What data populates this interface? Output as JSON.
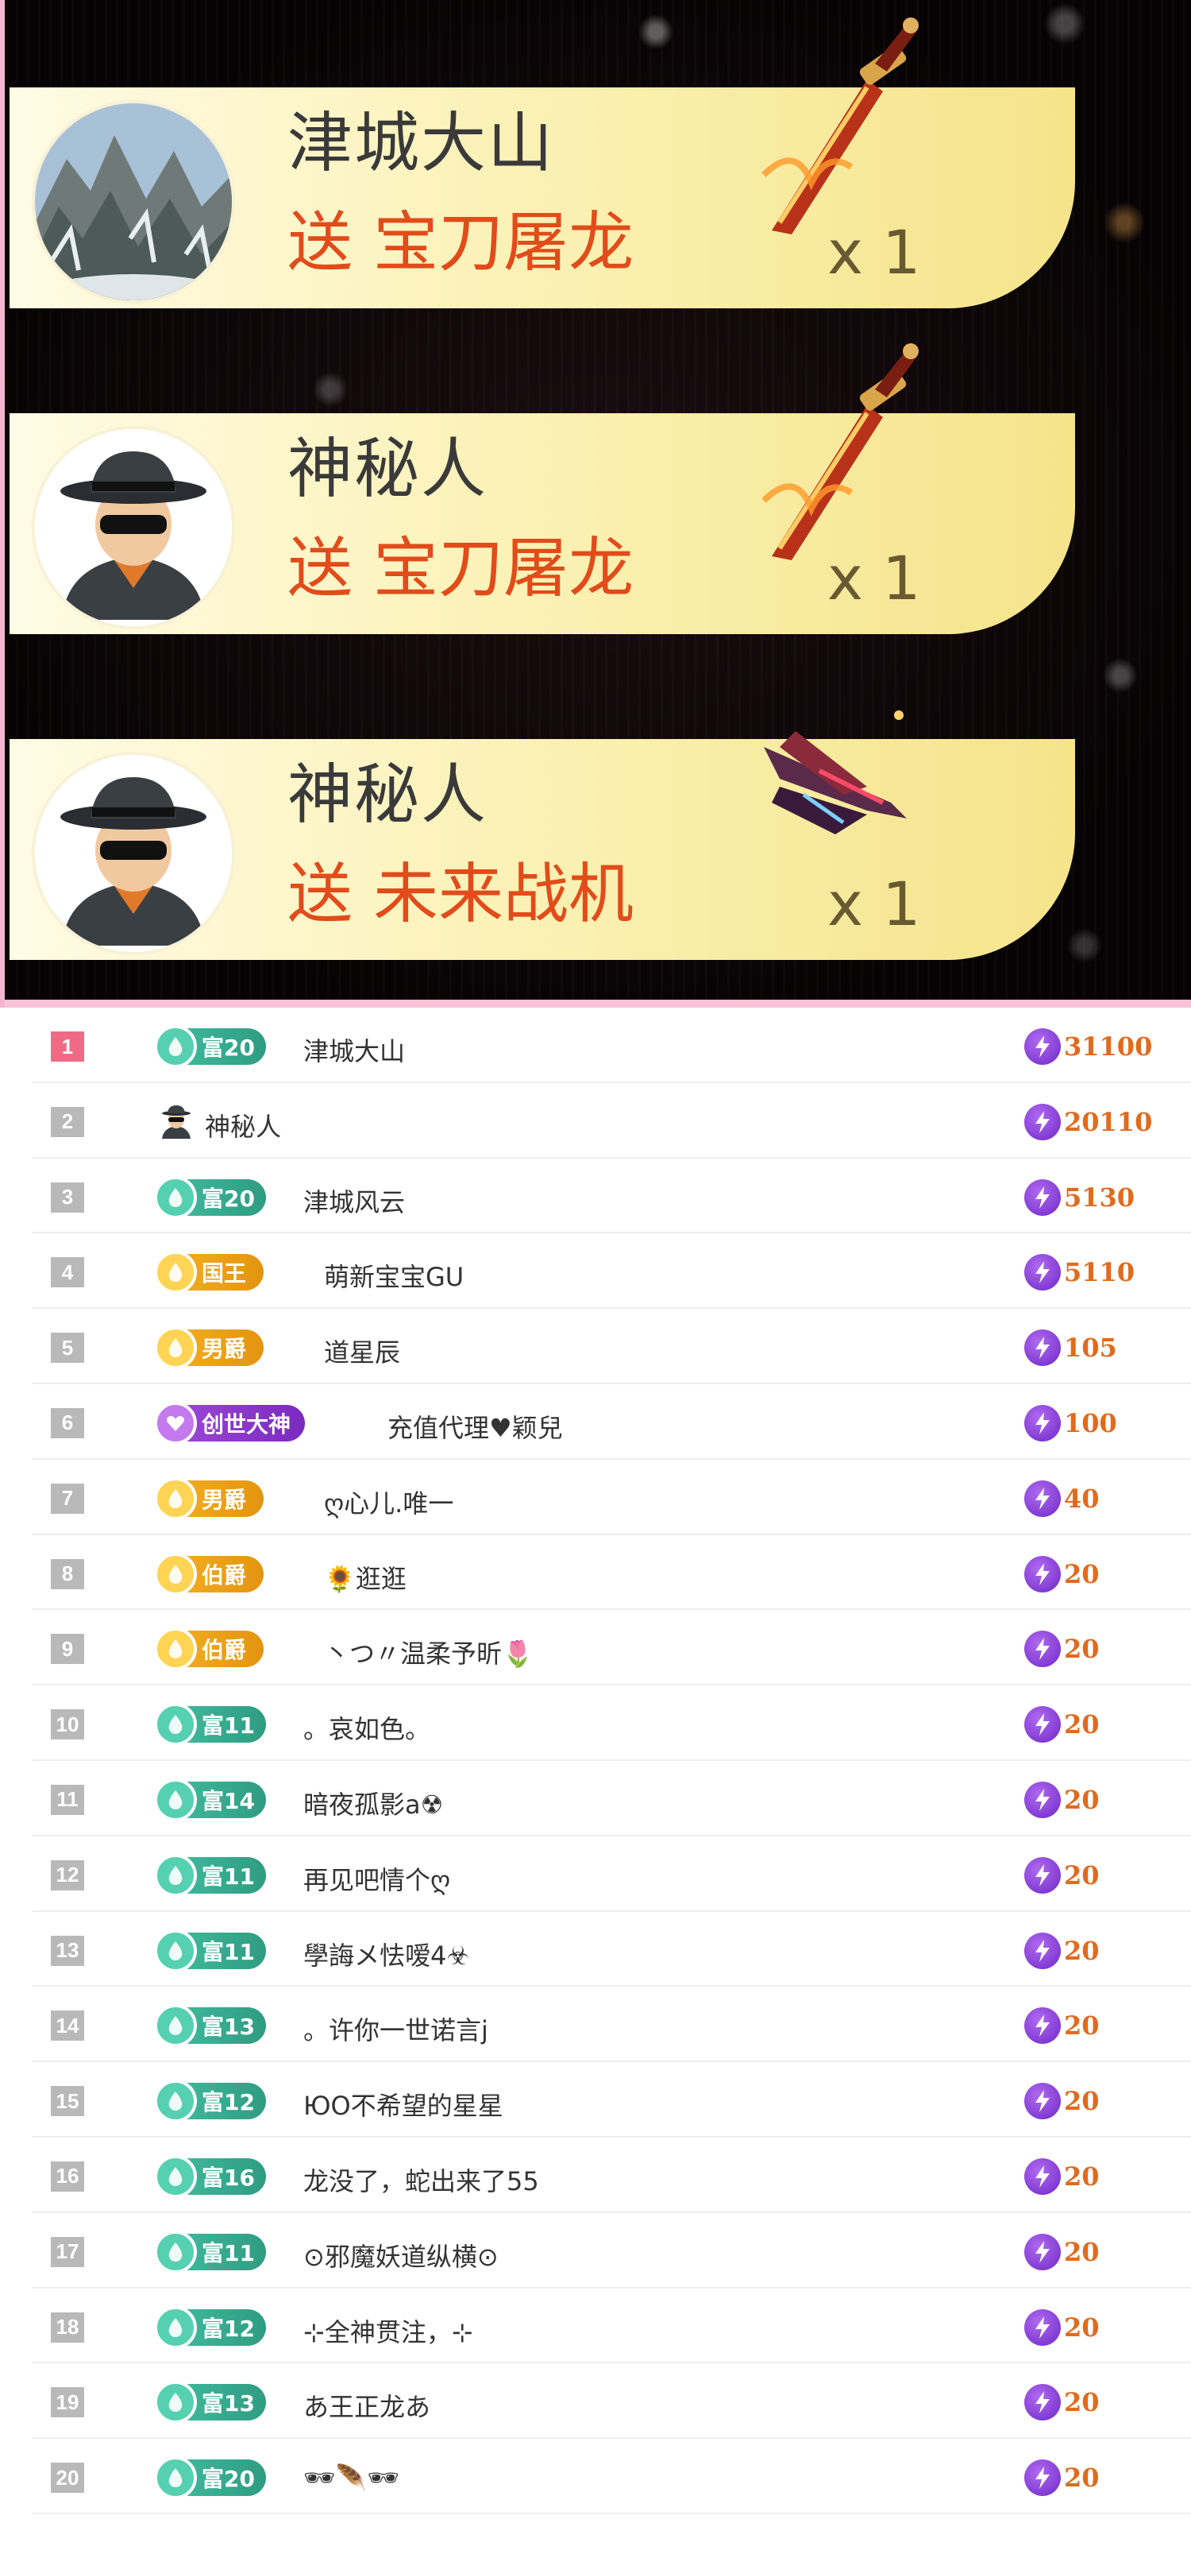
{
  "gift_feed": [
    {
      "sender": "津城大山",
      "verb": "送",
      "gift": "宝刀屠龙",
      "count": "x 1",
      "avatar": "landscape-avatar",
      "gift_icon": "dragon-sword-icon"
    },
    {
      "sender": "神秘人",
      "verb": "送",
      "gift": "宝刀屠龙",
      "count": "x 1",
      "avatar": "mystery-man-avatar",
      "gift_icon": "dragon-sword-icon"
    },
    {
      "sender": "神秘人",
      "verb": "送",
      "gift": "未来战机",
      "count": "x 1",
      "avatar": "mystery-man-avatar",
      "gift_icon": "future-fighter-jet-icon"
    }
  ],
  "ranking": [
    {
      "rank": "1",
      "badge_type": "rich",
      "badge_label": "富20",
      "name": "津城大山",
      "score": "31100"
    },
    {
      "rank": "2",
      "badge_type": "mystery",
      "badge_label": "",
      "name": "神秘人",
      "score": "20110"
    },
    {
      "rank": "3",
      "badge_type": "rich",
      "badge_label": "富20",
      "name": "津城风云",
      "score": "5130"
    },
    {
      "rank": "4",
      "badge_type": "noble",
      "badge_label": "国王",
      "name": "萌新宝宝GU",
      "score": "5110"
    },
    {
      "rank": "5",
      "badge_type": "noble",
      "badge_label": "男爵",
      "name": "道星辰",
      "score": "105"
    },
    {
      "rank": "6",
      "badge_type": "god",
      "badge_label": "创世大神",
      "name": "充值代理♥颖兒",
      "score": "100"
    },
    {
      "rank": "7",
      "badge_type": "noble",
      "badge_label": "男爵",
      "name": "ღ心儿.唯一",
      "score": "40"
    },
    {
      "rank": "8",
      "badge_type": "noble",
      "badge_label": "伯爵",
      "name": "🌻逛逛",
      "score": "20"
    },
    {
      "rank": "9",
      "badge_type": "noble",
      "badge_label": "伯爵",
      "name": "丶つ〃温柔予昕🌷",
      "score": "20"
    },
    {
      "rank": "10",
      "badge_type": "rich",
      "badge_label": "富11",
      "name": "。哀如色。",
      "score": "20"
    },
    {
      "rank": "11",
      "badge_type": "rich",
      "badge_label": "富14",
      "name": "暗夜孤影a☢",
      "score": "20"
    },
    {
      "rank": "12",
      "badge_type": "rich",
      "badge_label": "富11",
      "name": "再见吧情个ღ",
      "score": "20"
    },
    {
      "rank": "13",
      "badge_type": "rich",
      "badge_label": "富11",
      "name": "學誨メ怯嗳4☣",
      "score": "20"
    },
    {
      "rank": "14",
      "badge_type": "rich",
      "badge_label": "富13",
      "name": "。许你一世诺言j",
      "score": "20"
    },
    {
      "rank": "15",
      "badge_type": "rich",
      "badge_label": "富12",
      "name": "ЮО不希望的星星",
      "score": "20"
    },
    {
      "rank": "16",
      "badge_type": "rich",
      "badge_label": "富16",
      "name": "龙没了，蛇出来了55",
      "score": "20"
    },
    {
      "rank": "17",
      "badge_type": "rich",
      "badge_label": "富11",
      "name": "⊙邪魔妖道纵横⊙",
      "score": "20"
    },
    {
      "rank": "18",
      "badge_type": "rich",
      "badge_label": "富12",
      "name": "⊹全神贯注，⊹",
      "score": "20"
    },
    {
      "rank": "19",
      "badge_type": "rich",
      "badge_label": "富13",
      "name": "あ王正龙あ",
      "score": "20"
    },
    {
      "rank": "20",
      "badge_type": "rich",
      "badge_label": "富20",
      "name": "🕶🪶🕶",
      "score": "20"
    }
  ],
  "colors": {
    "accent_red": "#e24b1a",
    "score_orange": "#e26a1c",
    "rank_top": "#f06a86",
    "rank_gray": "#b9b9b9"
  }
}
